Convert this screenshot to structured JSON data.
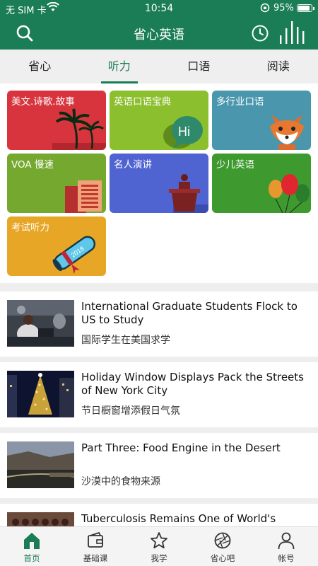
{
  "status_bar": {
    "carrier": "无 SIM 卡",
    "time": "10:54",
    "battery": "95%"
  },
  "header": {
    "title": "省心英语",
    "icons": [
      "search-icon",
      "clock-icon",
      "bars-icon"
    ]
  },
  "tabs": [
    {
      "label": "省心",
      "active": false
    },
    {
      "label": "听力",
      "active": true
    },
    {
      "label": "口语",
      "active": false
    },
    {
      "label": "阅读",
      "active": false
    }
  ],
  "categories": [
    {
      "label": "美文.诗歌.故事",
      "color": "#d8343d",
      "icon": "palm-trees-icon"
    },
    {
      "label": "英语口语宝典",
      "color": "#8cbf2e",
      "icon": "speech-bubble-hi-icon"
    },
    {
      "label": "多行业口语",
      "color": "#4a97ad",
      "icon": "fox-icon"
    },
    {
      "label": "VOA 慢速",
      "color": "#74a82e",
      "icon": "newspaper-icon"
    },
    {
      "label": "名人演讲",
      "color": "#4f63d1",
      "icon": "podium-icon"
    },
    {
      "label": "少儿英语",
      "color": "#3e9a2e",
      "icon": "balloons-icon"
    },
    {
      "label": "考试听力",
      "color": "#e7a626",
      "icon": "diploma-icon"
    }
  ],
  "articles": [
    {
      "title_en": "International Graduate Students Flock to US to Study",
      "title_zh": "国际学生在美国求学"
    },
    {
      "title_en": "Holiday Window Displays Pack the Streets of New York City",
      "title_zh": "节日橱窗增添假日气氛"
    },
    {
      "title_en": "Part Three: Food Engine in the Desert",
      "title_zh": "沙漠中的食物来源"
    },
    {
      "title_en": "Tuberculosis Remains One of World's Deadliest Diseases, but Vaccine Hopes...",
      "title_zh": ""
    }
  ],
  "bottom_nav": [
    {
      "label": "首页",
      "icon": "home-icon",
      "active": true
    },
    {
      "label": "基础课",
      "icon": "wallet-icon",
      "active": false
    },
    {
      "label": "我学",
      "icon": "star-icon",
      "active": false
    },
    {
      "label": "省心吧",
      "icon": "aperture-icon",
      "active": false
    },
    {
      "label": "帐号",
      "icon": "person-icon",
      "active": false
    }
  ],
  "colors": {
    "brand": "#1a7d55",
    "tab_bg": "#efefef",
    "nav_bg": "#f4f4f4"
  }
}
